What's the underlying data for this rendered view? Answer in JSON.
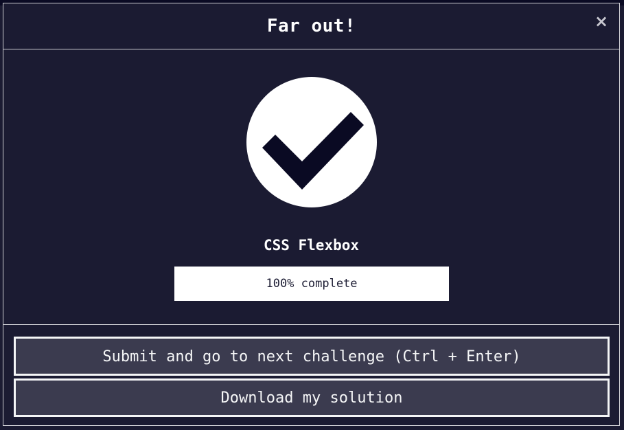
{
  "modal": {
    "title": "Far out!",
    "close_label": "×",
    "challenge_name": "CSS Flexbox",
    "progress": {
      "percent": 100,
      "label": "100% complete"
    },
    "buttons": {
      "submit_label": "Submit and go to next challenge (Ctrl + Enter)",
      "download_label": "Download my solution"
    }
  },
  "icons": {
    "success": "check-mark-icon",
    "close": "close-icon"
  },
  "colors": {
    "background": "#1b1b32",
    "check_mark": "#0a0a23",
    "button_bg": "#3b3b4f",
    "border": "#f5f6f7"
  }
}
